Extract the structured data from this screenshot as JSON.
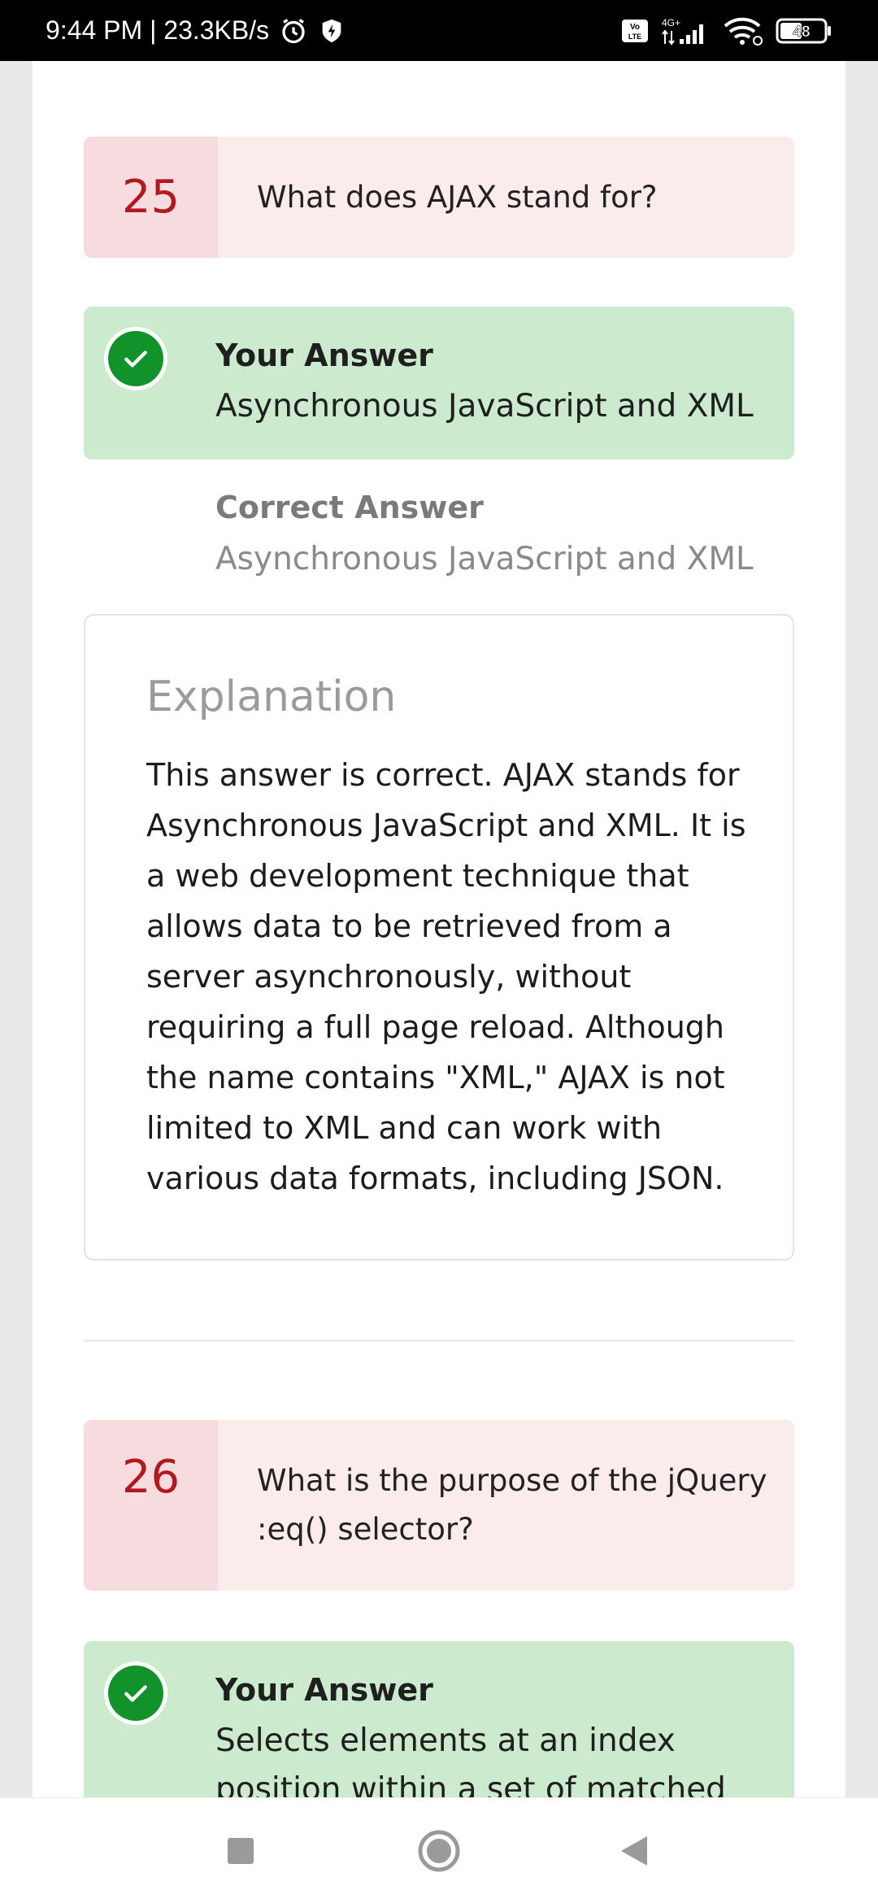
{
  "status_bar": {
    "time_speed": "9:44 PM | 23.3KB/s",
    "network": "4G+",
    "volte": "Vo LTE",
    "battery": "48",
    "icons": [
      "alarm-icon",
      "shield-icon",
      "volte-icon",
      "signal-icon",
      "wifi-icon",
      "battery-icon"
    ]
  },
  "questions": [
    {
      "number": "25",
      "text": "What does AJAX stand for?",
      "your_answer_label": "Your Answer",
      "your_answer": "Asynchronous JavaScript and XML",
      "correct_answer_label": "Correct Answer",
      "correct_answer": "Asynchronous JavaScript and XML",
      "explanation_title": "Explanation",
      "explanation": "This answer is correct. AJAX stands for Asynchronous JavaScript and XML. It is a web development technique that allows data to be retrieved from a server asynchronously, without requiring a full page reload. Although the name contains \"XML,\" AJAX is not limited to XML and can work with various data formats, including JSON."
    },
    {
      "number": "26",
      "text": "What is the purpose of the jQuery :eq() selector?",
      "your_answer_label": "Your Answer",
      "your_answer": "Selects elements at an index position within a set of matched"
    }
  ],
  "colors": {
    "question_bg": "#fbecec",
    "question_num_bg": "#f6dcdf",
    "question_num": "#b3171f",
    "answer_bg": "#cceacd",
    "check_green": "#12922a"
  },
  "nav": {
    "icons": [
      "recent-apps-icon",
      "home-icon",
      "back-icon"
    ]
  }
}
